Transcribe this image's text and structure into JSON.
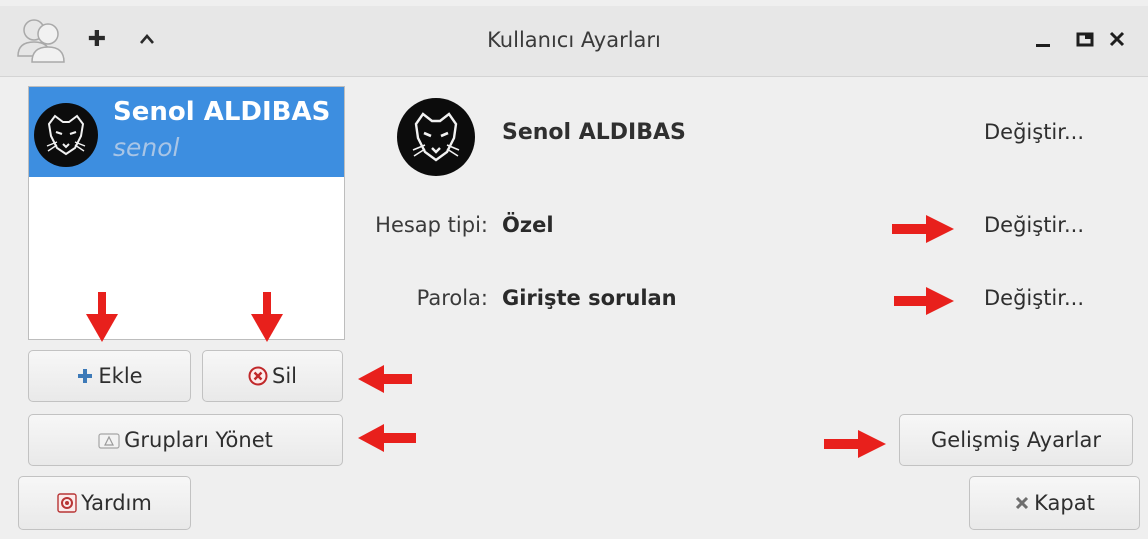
{
  "window": {
    "title": "Kullanıcı Ayarları",
    "app_icon": "users-icon",
    "titlebar_buttons": [
      {
        "name": "pin-icon",
        "glyph": "✚"
      },
      {
        "name": "chevron-up-icon",
        "glyph": "⌃"
      }
    ],
    "controls": {
      "minimize": "_",
      "maximize": "▭",
      "close": "✕"
    }
  },
  "user_list": {
    "items": [
      {
        "name": "Senol ALDIBAS",
        "login": "senol",
        "selected": true,
        "avatar": "panther-avatar-icon"
      }
    ]
  },
  "details": {
    "name": "Senol ALDIBAS",
    "change_label": "Değiştir...",
    "account_type_label": "Hesap tipi:",
    "account_type_value": "Özel",
    "password_label": "Parola:",
    "password_value": "Girişte sorulan"
  },
  "buttons": {
    "add": "Ekle",
    "remove": "Sil",
    "manage_groups": "Grupları Yönet",
    "advanced": "Gelişmiş Ayarlar",
    "help": "Yardım",
    "close": "Kapat"
  },
  "colors": {
    "selection": "#3d8ee0",
    "annotation_arrow": "#e8201c"
  }
}
